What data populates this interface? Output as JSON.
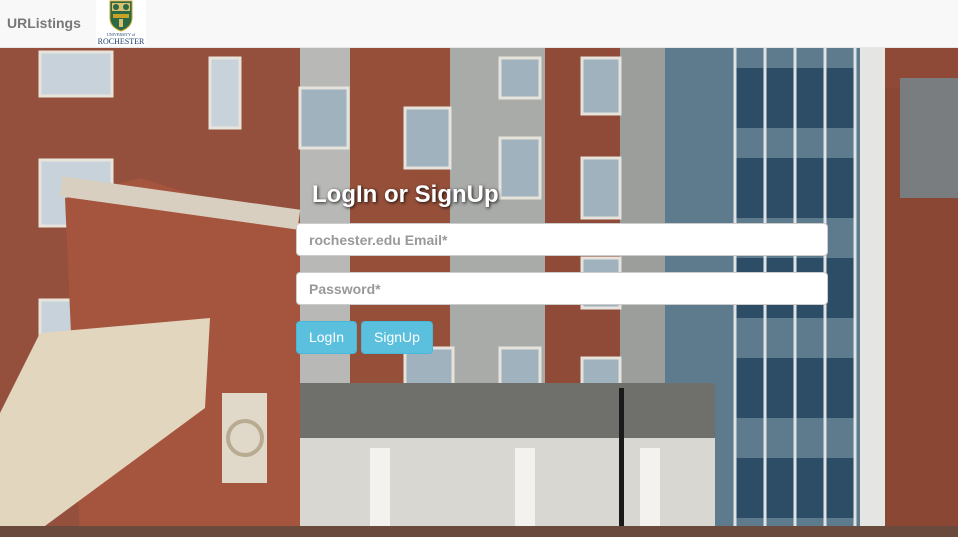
{
  "navbar": {
    "brand": "URListings",
    "logo": {
      "icon": "university-of-rochester-logo",
      "text_top": "UNIVERSITY of",
      "text_main": "ROCHESTER"
    }
  },
  "login": {
    "title": "LogIn or SignUp",
    "email_placeholder": "rochester.edu Email*",
    "password_placeholder": "Password*",
    "login_label": "LogIn",
    "signup_label": "SignUp"
  },
  "colors": {
    "button": "#5bc0de",
    "navbar_bg": "#f8f8f8",
    "brand_text": "#777777",
    "logo_shield": "#1f5a3a",
    "logo_text": "#1c3d6e"
  }
}
